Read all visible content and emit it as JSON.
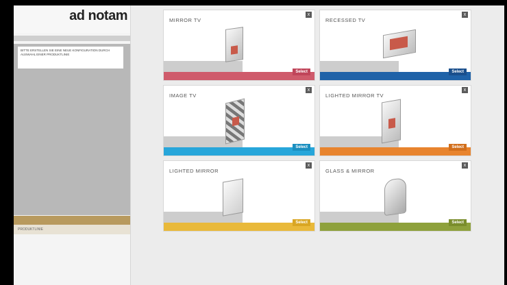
{
  "brand": {
    "logo": "ad notam",
    "tagline": ""
  },
  "sidebar": {
    "note": "BITTE ERSTELLEN SIE EINE NEUE KONFIGURATION DURCH AUSWAHL EINER PRODUKTLINIE",
    "footer_label": "PRODUKTLINIE"
  },
  "cards": [
    {
      "title": "MIRROR TV",
      "select": "Select",
      "close": "x",
      "accent": "#cf5b6b",
      "button": "#c0455a"
    },
    {
      "title": "RECESSED TV",
      "select": "Select",
      "close": "x",
      "accent": "#1f62a8",
      "button": "#1a4f8c"
    },
    {
      "title": "IMAGE TV",
      "select": "Select",
      "close": "x",
      "accent": "#27a6da",
      "button": "#1b8fc0"
    },
    {
      "title": "LIGHTED MIRROR TV",
      "select": "Select",
      "close": "x",
      "accent": "#e8842e",
      "button": "#d26f1c"
    },
    {
      "title": "LIGHTED MIRROR",
      "select": "Select",
      "close": "x",
      "accent": "#e9b93a",
      "button": "#d9a623"
    },
    {
      "title": "GLASS & MIRROR",
      "select": "Select",
      "close": "x",
      "accent": "#8ea13c",
      "button": "#7a8d2c"
    }
  ]
}
